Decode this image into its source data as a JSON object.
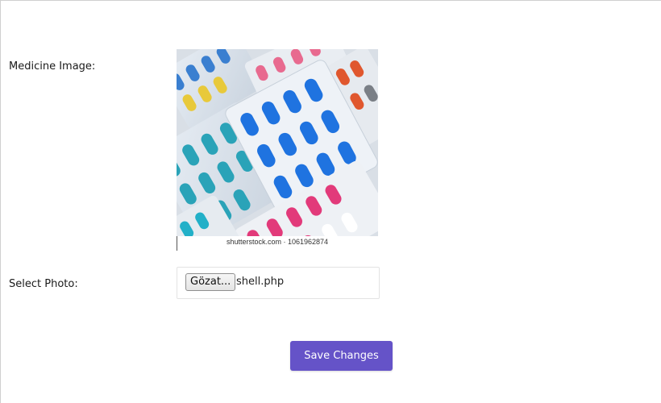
{
  "form": {
    "medicine_image_label": "Medicine Image:",
    "select_photo_label": "Select Photo:",
    "browse_button_label": "Gözat...",
    "selected_file_name": "shell.php",
    "save_button_label": "Save Changes"
  },
  "image": {
    "watermark_text": "shutterstock.com · 1061962874"
  },
  "colors": {
    "accent": "#6553c8"
  }
}
